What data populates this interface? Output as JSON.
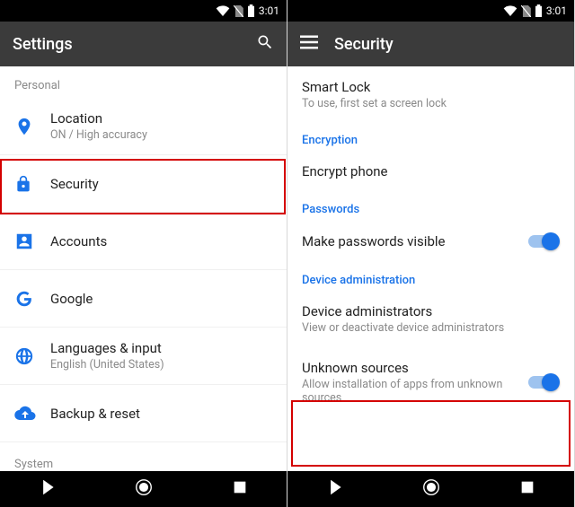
{
  "status": {
    "time": "3:01"
  },
  "left": {
    "title": "Settings",
    "section_personal": "Personal",
    "section_system": "System",
    "items": {
      "location": {
        "primary": "Location",
        "secondary": "ON / High accuracy"
      },
      "security": {
        "primary": "Security"
      },
      "accounts": {
        "primary": "Accounts"
      },
      "google": {
        "primary": "Google"
      },
      "languages": {
        "primary": "Languages & input",
        "secondary": "English (United States)"
      },
      "backup": {
        "primary": "Backup & reset"
      }
    }
  },
  "right": {
    "title": "Security",
    "smart_lock": {
      "primary": "Smart Lock",
      "secondary": "To use, first set a screen lock"
    },
    "section_encryption": "Encryption",
    "encrypt_phone": {
      "primary": "Encrypt phone"
    },
    "section_passwords": "Passwords",
    "passwords_visible": {
      "primary": "Make passwords visible"
    },
    "section_device_admin": "Device administration",
    "device_admins": {
      "primary": "Device administrators",
      "secondary": "View or deactivate device administrators"
    },
    "unknown_sources": {
      "primary": "Unknown sources",
      "secondary": "Allow installation of apps from unknown sources"
    }
  }
}
